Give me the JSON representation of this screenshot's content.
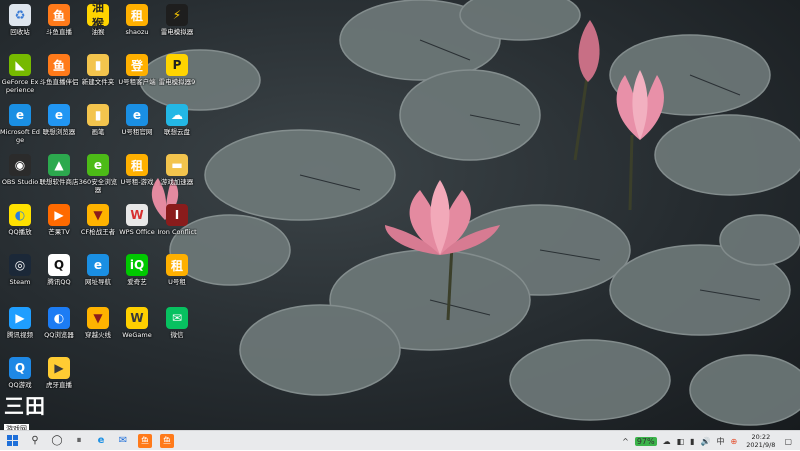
{
  "desktop": {
    "icons": [
      {
        "label": "回收站",
        "glyph": "♻",
        "bg": "#dfe6ee",
        "fg": "#3a7bd5"
      },
      {
        "label": "斗鱼直播",
        "glyph": "鱼",
        "bg": "#ff7a1a",
        "fg": "#fff"
      },
      {
        "label": "油猴",
        "glyph": "油猴",
        "bg": "#ffd400",
        "fg": "#222"
      },
      {
        "label": "shaozu",
        "glyph": "租",
        "bg": "#ffb000",
        "fg": "#fff"
      },
      {
        "label": "雷电模拟器",
        "glyph": "⚡",
        "bg": "#1e1e1e",
        "fg": "#ffcc00"
      },
      {
        "label": "GeForce Experience",
        "glyph": "◣",
        "bg": "#76b900",
        "fg": "#fff"
      },
      {
        "label": "斗鱼直播伴侣",
        "glyph": "鱼",
        "bg": "#ff7a1a",
        "fg": "#fff"
      },
      {
        "label": "新建文件夹",
        "glyph": "▮",
        "bg": "#f3c44d",
        "fg": "#fff"
      },
      {
        "label": "U号租客户端",
        "glyph": "登",
        "bg": "#ffb000",
        "fg": "#fff"
      },
      {
        "label": "雷电模拟器9",
        "glyph": "P",
        "bg": "#ffd400",
        "fg": "#222"
      },
      {
        "label": "Microsoft Edge",
        "glyph": "e",
        "bg": "#1a8fe3",
        "fg": "#fff"
      },
      {
        "label": "联想浏览器",
        "glyph": "e",
        "bg": "#2196f3",
        "fg": "#fff"
      },
      {
        "label": "画笔",
        "glyph": "▮",
        "bg": "#f3c44d",
        "fg": "#fff"
      },
      {
        "label": "U号租官网",
        "glyph": "e",
        "bg": "#1a8fe3",
        "fg": "#fff"
      },
      {
        "label": "联想云盘",
        "glyph": "☁",
        "bg": "#23b7e5",
        "fg": "#fff"
      },
      {
        "label": "OBS Studio",
        "glyph": "◉",
        "bg": "#2b2b2b",
        "fg": "#fff"
      },
      {
        "label": "联想软件商店",
        "glyph": "▲",
        "bg": "#2ca94e",
        "fg": "#fff"
      },
      {
        "label": "360安全浏览器",
        "glyph": "e",
        "bg": "#4cbb17",
        "fg": "#fff"
      },
      {
        "label": "U号租-游戏",
        "glyph": "租",
        "bg": "#ffb000",
        "fg": "#fff"
      },
      {
        "label": "游戏加速器",
        "glyph": "▬",
        "bg": "#f3c44d",
        "fg": "#fff"
      },
      {
        "label": "QQ播放",
        "glyph": "◐",
        "bg": "#ffe100",
        "fg": "#2a7de1"
      },
      {
        "label": "芒果TV",
        "glyph": "▶",
        "bg": "#ff6a00",
        "fg": "#fff"
      },
      {
        "label": "CF枪战王者",
        "glyph": "▼",
        "bg": "#ffb300",
        "fg": "#8a1c1c"
      },
      {
        "label": "WPS Office",
        "glyph": "W",
        "bg": "#e8e8e8",
        "fg": "#d82f2f"
      },
      {
        "label": "Iron Conflict",
        "glyph": "I",
        "bg": "#8a1c1c",
        "fg": "#fff"
      },
      {
        "label": "Steam",
        "glyph": "◎",
        "bg": "#1b2838",
        "fg": "#fff"
      },
      {
        "label": "腾讯QQ",
        "glyph": "Q",
        "bg": "#ffffff",
        "fg": "#111"
      },
      {
        "label": "网址导航",
        "glyph": "e",
        "bg": "#1a8fe3",
        "fg": "#fff"
      },
      {
        "label": "爱奇艺",
        "glyph": "iQ",
        "bg": "#00c800",
        "fg": "#fff"
      },
      {
        "label": "U号租",
        "glyph": "租",
        "bg": "#ffb000",
        "fg": "#fff"
      },
      {
        "label": "腾讯视频",
        "glyph": "▶",
        "bg": "#1f9eff",
        "fg": "#fff"
      },
      {
        "label": "QQ浏览器",
        "glyph": "◐",
        "bg": "#1c7cf4",
        "fg": "#fff"
      },
      {
        "label": "穿越火线",
        "glyph": "▼",
        "bg": "#ffb300",
        "fg": "#8a1c1c"
      },
      {
        "label": "WeGame",
        "glyph": "W",
        "bg": "#ffd000",
        "fg": "#3a3a3a"
      },
      {
        "label": "微信",
        "glyph": "✉",
        "bg": "#07c160",
        "fg": "#fff"
      },
      {
        "label": "QQ游戏",
        "glyph": "Q",
        "bg": "#1e88e5",
        "fg": "#fff"
      },
      {
        "label": "虎牙直播",
        "glyph": "▶",
        "bg": "#ffcc33",
        "fg": "#3a3a3a"
      }
    ]
  },
  "watermark": {
    "big": "三田",
    "small": "游戏网"
  },
  "taskbar": {
    "start_icon": "start-icon",
    "items": [
      "⚲",
      "◯",
      "⏸",
      "e",
      "✉",
      "鱼",
      "鱼"
    ],
    "tray": {
      "arrow": "^",
      "battery": "97%",
      "icons": [
        "☁",
        "◧",
        "▮",
        "🔊",
        "中",
        "⊕"
      ],
      "time": "20:22",
      "date": "2021/9/8",
      "notification": "▢"
    }
  }
}
